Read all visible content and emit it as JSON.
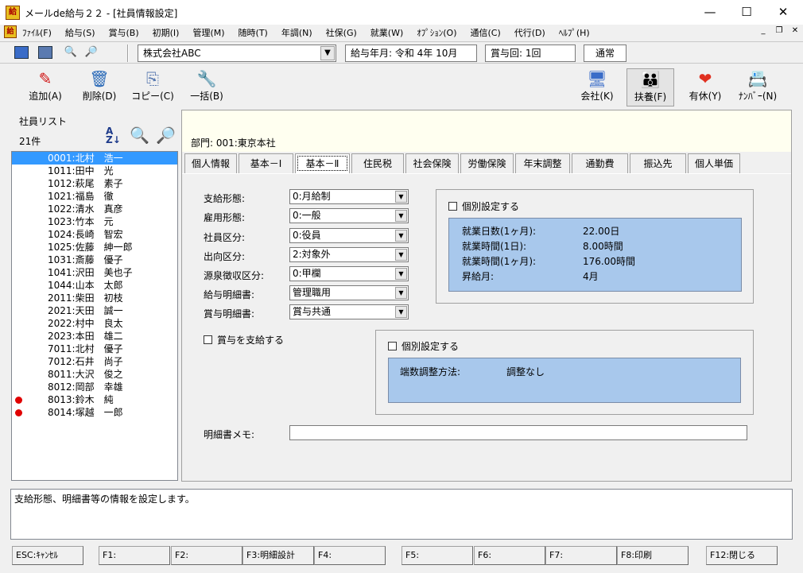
{
  "window": {
    "title": "メールde給与２２ - [社員情報設定]",
    "app_icon": "給"
  },
  "menu": [
    "ﾌｧｲﾙ(F)",
    "給与(S)",
    "賞与(B)",
    "初期(I)",
    "管理(M)",
    "随時(T)",
    "年調(N)",
    "社保(G)",
    "就業(W)",
    "ｵﾌﾟｼｮﾝ(O)",
    "通信(C)",
    "代行(D)",
    "ﾍﾙﾌﾟ(H)"
  ],
  "toolbar": {
    "company": "株式会社ABC",
    "pay_month": "給与年月: 令和  4年 10月",
    "bonus_count": "賞与回: 1回",
    "mode": "通常"
  },
  "buttons": {
    "add": "追加(A)",
    "delete": "削除(D)",
    "copy": "コピー(C)",
    "bulk": "一括(B)",
    "company": "会社(K)",
    "dependents": "扶養(F)",
    "leave": "有休(Y)",
    "number": "ﾅﾝﾊﾞｰ(N)"
  },
  "employee_list": {
    "title": "社員リスト",
    "count": "21件",
    "items": [
      {
        "text": "0001:北村　浩一",
        "dot": false
      },
      {
        "text": "1011:田中　光",
        "dot": false
      },
      {
        "text": "1012:萩尾　素子",
        "dot": false
      },
      {
        "text": "1021:福島　徹",
        "dot": false
      },
      {
        "text": "1022:清水　真彦",
        "dot": false
      },
      {
        "text": "1023:竹本　元",
        "dot": false
      },
      {
        "text": "1024:長崎　智宏",
        "dot": false
      },
      {
        "text": "1025:佐藤　紳一郎",
        "dot": false
      },
      {
        "text": "1031:斎藤　優子",
        "dot": false
      },
      {
        "text": "1041:沢田　美也子",
        "dot": false
      },
      {
        "text": "1044:山本　太郎",
        "dot": false
      },
      {
        "text": "2011:柴田　初枝",
        "dot": false
      },
      {
        "text": "2021:天田　誠一",
        "dot": false
      },
      {
        "text": "2022:村中　良太",
        "dot": false
      },
      {
        "text": "2023:本田　雄二",
        "dot": false
      },
      {
        "text": "7011:北村　優子",
        "dot": false
      },
      {
        "text": "7012:石井　尚子",
        "dot": false
      },
      {
        "text": "8011:大沢　俊之",
        "dot": false
      },
      {
        "text": "8012:岡部　幸雄",
        "dot": false
      },
      {
        "text": "8013:鈴木　純",
        "dot": true
      },
      {
        "text": "8014:塚越　一郎",
        "dot": true
      }
    ]
  },
  "department": "部門:  001:東京本社",
  "tabs": [
    "個人情報",
    "基本－Ⅰ",
    "基本－Ⅱ",
    "住民税",
    "社会保険",
    "労働保険",
    "年末調整",
    "通勤費",
    "振込先",
    "個人単価"
  ],
  "form": {
    "pay_type": {
      "label": "支給形態:",
      "value": "0:月給制"
    },
    "employment_type": {
      "label": "雇用形態:",
      "value": "0:一般"
    },
    "employee_class": {
      "label": "社員区分:",
      "value": "0:役員"
    },
    "secondment": {
      "label": "出向区分:",
      "value": "2:対象外"
    },
    "withholding": {
      "label": "源泉徴収区分:",
      "value": "0:甲欄"
    },
    "pay_statement": {
      "label": "給与明細書:",
      "value": "管理職用"
    },
    "bonus_statement": {
      "label": "賞与明細書:",
      "value": "賞与共通"
    },
    "bonus_pay_check": "賞与を支給する",
    "memo_label": "明細書メモ:"
  },
  "individual_setting": {
    "check": "個別設定する",
    "rows": [
      {
        "k": "就業日数(1ヶ月):",
        "v": "22.00日"
      },
      {
        "k": "就業時間(1日):",
        "v": "8.00時間"
      },
      {
        "k": "就業時間(1ヶ月):",
        "v": "176.00時間"
      },
      {
        "k": "昇給月:",
        "v": "4月"
      }
    ]
  },
  "rounding_setting": {
    "check": "個別設定する",
    "key": "端数調整方法:",
    "value": "調整なし"
  },
  "status_text": "支給形態、明細書等の情報を設定します。",
  "fkeys": [
    "ESC:ｷｬﾝｾﾙ",
    "F1:",
    "F2:",
    "F3:明細設計",
    "F4:",
    "F5:",
    "F6:",
    "F7:",
    "F8:印刷",
    "F12:閉じる"
  ]
}
